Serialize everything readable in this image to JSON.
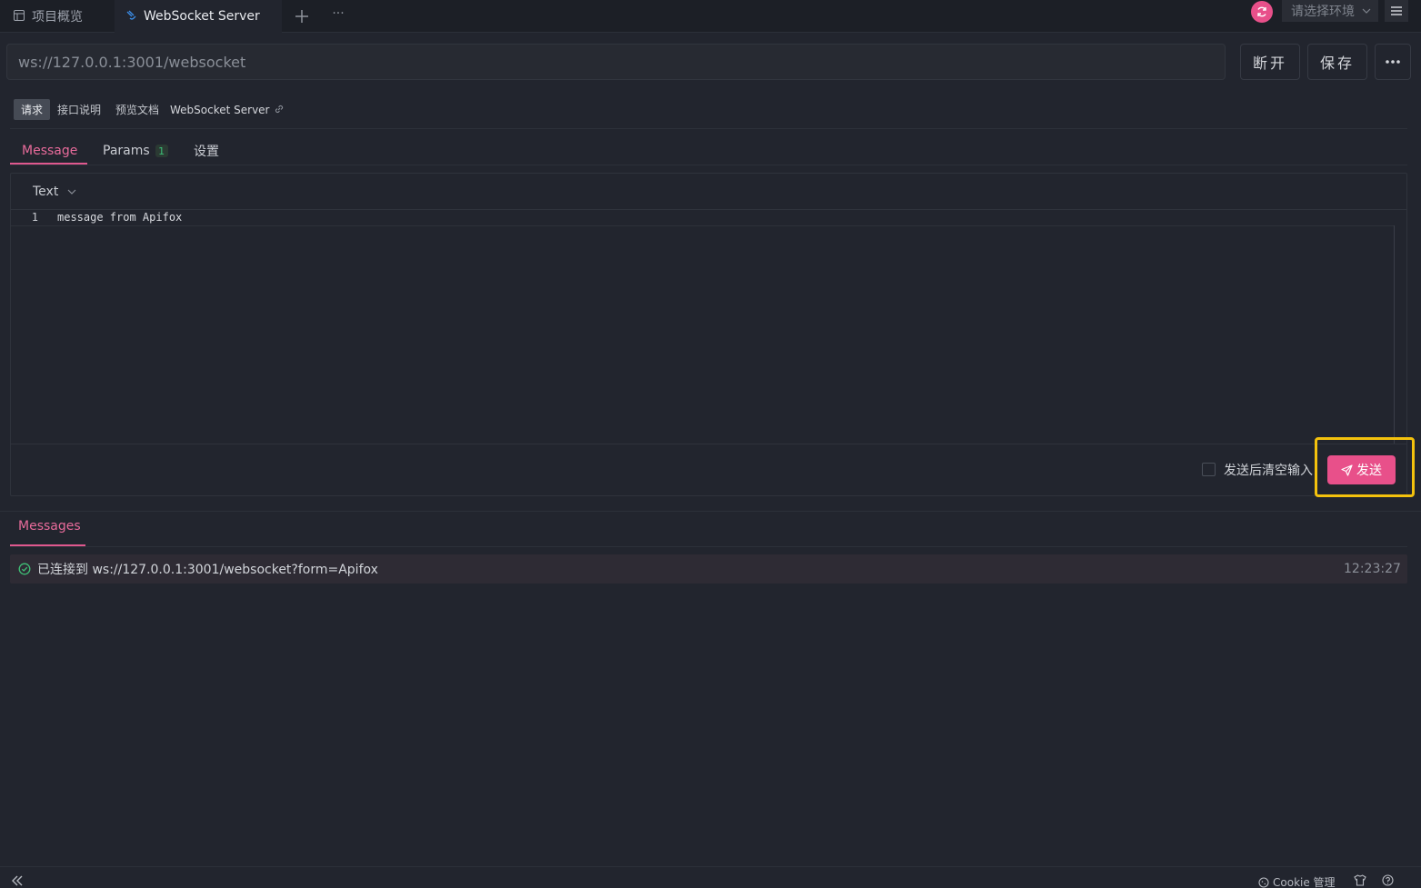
{
  "tabs": [
    {
      "label": "项目概览",
      "icon": "layout-icon",
      "active": false
    },
    {
      "label": "WebSocket Server",
      "icon": "websocket-icon",
      "active": true
    }
  ],
  "tabbar": {
    "add": "+",
    "more": "···"
  },
  "environment": {
    "placeholder": "请选择环境"
  },
  "request": {
    "url": "ws://127.0.0.1:3001/websocket",
    "disconnect_label": "断开",
    "save_label": "保存"
  },
  "subnav": {
    "items": [
      "请求",
      "接口说明",
      "预览文档"
    ],
    "name": "WebSocket Server"
  },
  "message_tabs": [
    {
      "label": "Message"
    },
    {
      "label": "Params",
      "count": "1"
    },
    {
      "label": "设置"
    }
  ],
  "editor": {
    "format": "Text",
    "line_number": "1",
    "content": "message from Apifox"
  },
  "send_bar": {
    "clear_after_send": "发送后清空输入",
    "send_label": "发送"
  },
  "messages": {
    "tab_label": "Messages",
    "items": [
      {
        "text": "已连接到 ws://127.0.0.1:3001/websocket?form=Apifox",
        "time": "12:23:27"
      }
    ]
  },
  "footer": {
    "cookie_label": "Cookie 管理"
  },
  "colors": {
    "accent": "#e8508a",
    "highlight": "#f4c20d",
    "background": "#22252e"
  }
}
